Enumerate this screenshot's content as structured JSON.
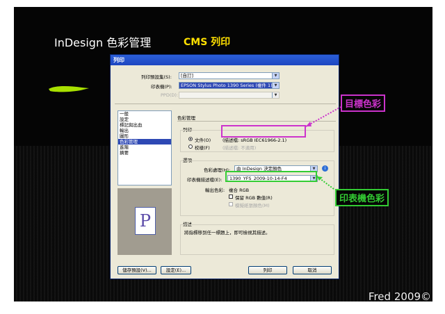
{
  "slide": {
    "title": "InDesign 色彩管理",
    "subtitle": "CMS 列印",
    "footer": "Fred 2009©"
  },
  "dialog": {
    "title": "列印",
    "preset_label": "列印預設集(S):",
    "preset_value": "[自訂]",
    "printer_label": "印表機(P):",
    "printer_value": "EPSON Stylus Photo 1390 Series (複件 1)",
    "ppd_label": "PPD(D):",
    "sidebar": {
      "items": [
        "一般",
        "設定",
        "標記與出血",
        "輸出",
        "圖形",
        "色彩管理",
        "進階",
        "摘要"
      ],
      "active_index": 5
    },
    "preview_glyph": "P",
    "section_title": "色彩管理",
    "print_group": {
      "title": "列印",
      "document_label": "文件(O)",
      "document_profile": "(描述檔: sRGB IEC61966-2.1)",
      "proof_label": "校樣(F)",
      "proof_profile": "(描述檔: 不適用)",
      "selected": "document"
    },
    "options": {
      "title": "選項",
      "color_handling_label": "色彩處理(H):",
      "color_handling_value": "由 InDesign 決定顏色",
      "printer_profile_label": "印表機描述檔(E):",
      "printer_profile_value": "1390_YFS_2009-10-14-F4",
      "output_color_label": "輸出色彩:",
      "output_color_value": "複合 RGB",
      "preserve_rgb_label": "保留 RGB 數值(R)",
      "simulate_paper_label": "模擬紙張顏色(M)"
    },
    "description": {
      "title": "描述",
      "text": "將指標移到任一標題上，即可檢視其描述。"
    },
    "buttons": {
      "save_preset": "儲存預設(V)...",
      "setup": "設定(E)...",
      "print": "列印",
      "cancel": "取消"
    }
  },
  "callouts": {
    "target_color": "目標色彩",
    "printer_color": "印表機色彩"
  },
  "colors": {
    "subtitle": "#ffe000",
    "target_callout": "#cc33cc",
    "printer_callout": "#33cc33",
    "brush": "#a8e000",
    "selection": "#2e48b4"
  }
}
